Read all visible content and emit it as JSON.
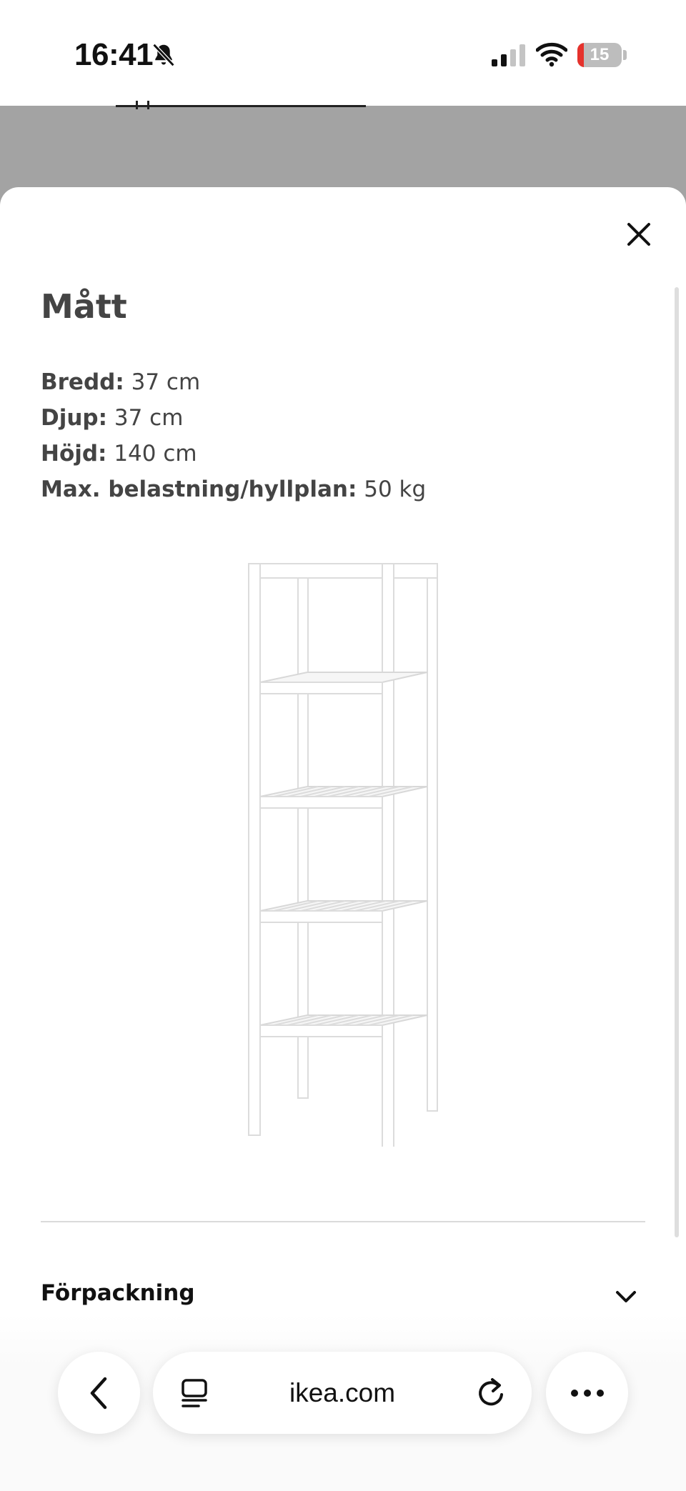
{
  "status_bar": {
    "time": "16:41",
    "battery_level": "15",
    "battery_fraction": 0.15,
    "icons": [
      "bell-slash-icon",
      "cellular-signal-icon",
      "wifi-icon",
      "battery-icon"
    ]
  },
  "sheet": {
    "title": "Mått",
    "close_icon": "close-icon",
    "specs": [
      {
        "label": "Bredd:",
        "value": "37 cm"
      },
      {
        "label": "Djup:",
        "value": "37 cm"
      },
      {
        "label": "Höjd:",
        "value": "140 cm"
      },
      {
        "label": "Max. belastning/hyllplan:",
        "value": "50 kg"
      }
    ],
    "image_alt": "white shelving unit with five slatted shelves",
    "accordion": {
      "label": "Förpackning",
      "icon": "chevron-down-icon"
    }
  },
  "browser_bar": {
    "url": "ikea.com",
    "icons": [
      "chevron-left-icon",
      "tabs-icon",
      "reload-icon",
      "more-icon"
    ]
  },
  "colors": {
    "background_dim": "#a3a3a3",
    "sheet": "#ffffff",
    "text_muted": "#444444",
    "battery_low": "#e5322c"
  }
}
